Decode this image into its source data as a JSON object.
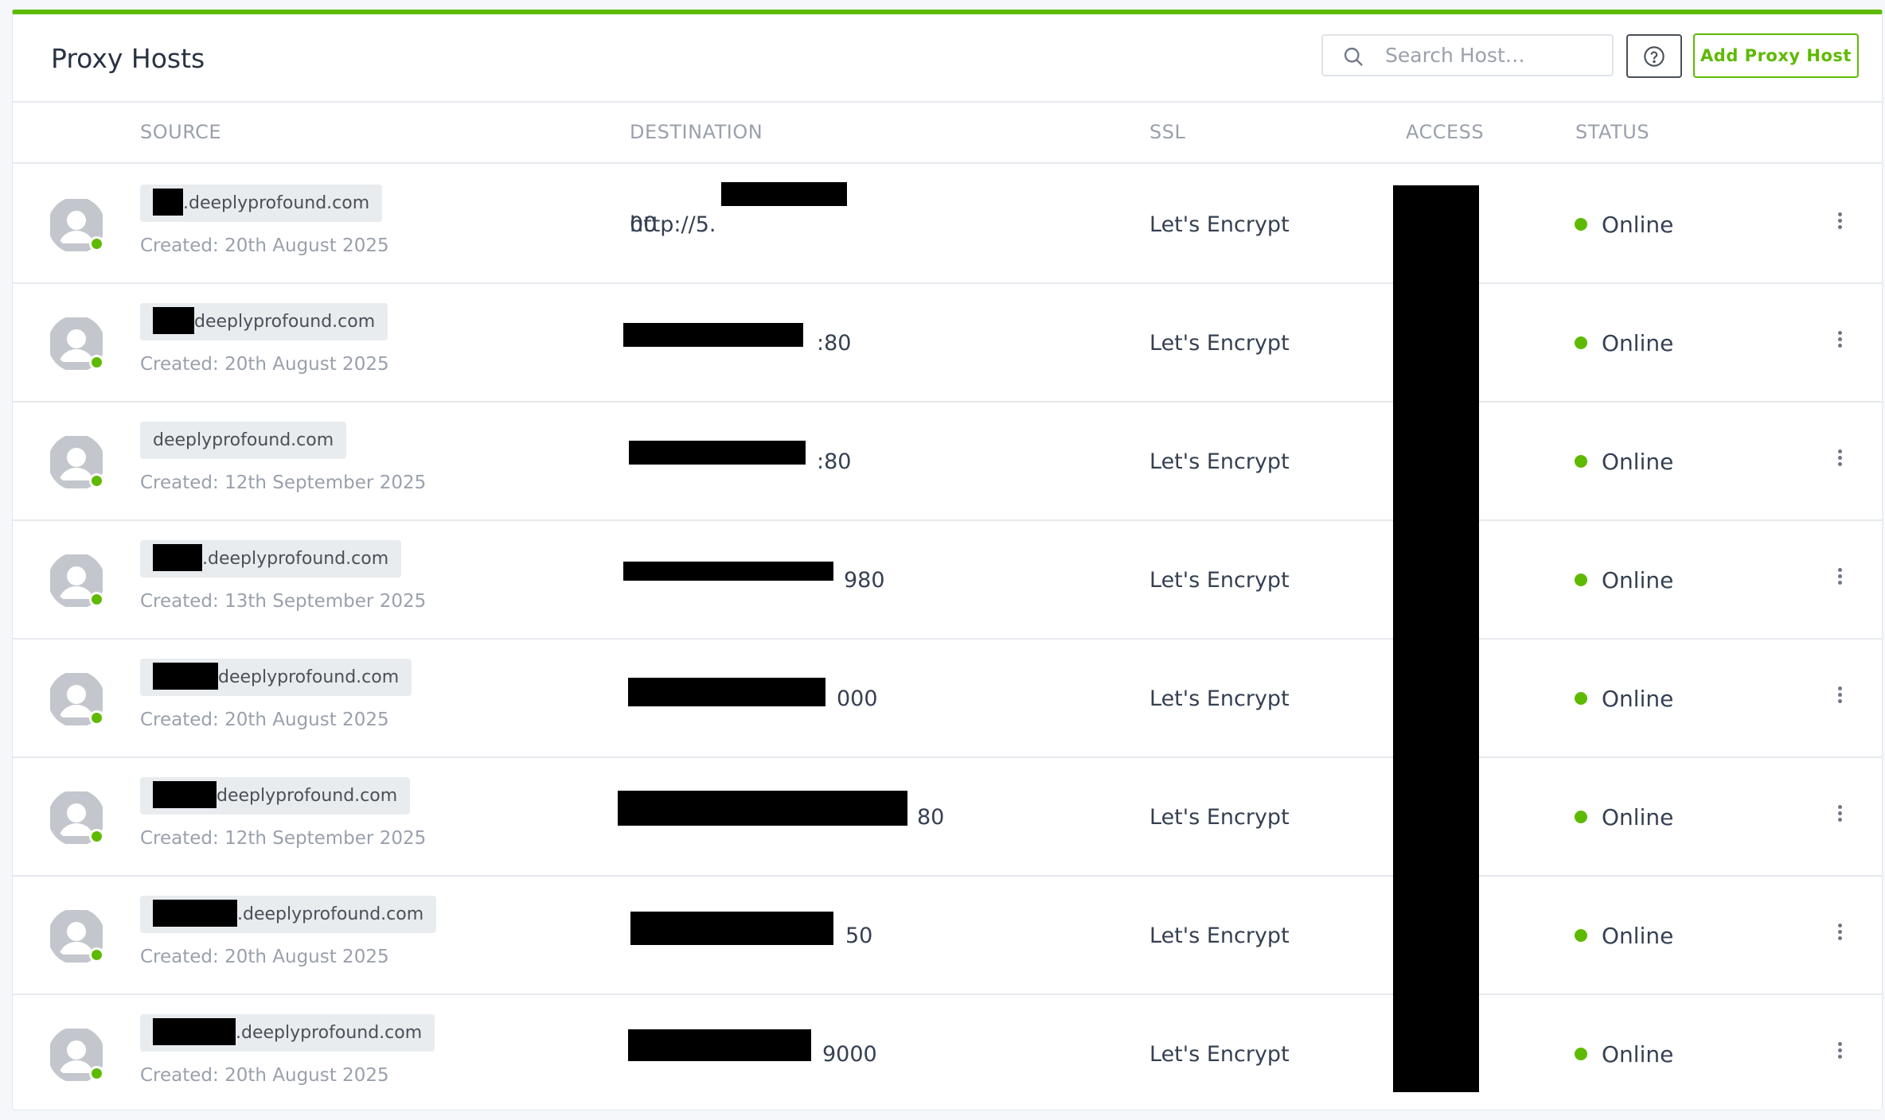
{
  "header": {
    "title": "Proxy Hosts",
    "search_placeholder": "Search Host…",
    "add_button_label": "Add Proxy Host"
  },
  "columns": {
    "source": "SOURCE",
    "destination": "DESTINATION",
    "ssl": "SSL",
    "access": "ACCESS",
    "status": "STATUS"
  },
  "rows": [
    {
      "domain": ".deeplyprofound.com",
      "created": "Created: 20th August 2025",
      "dest_prefix": "http://5.",
      "dest_suffix": "00",
      "ssl": "Let's Encrypt",
      "status": "Online"
    },
    {
      "domain": "deeplyprofound.com",
      "created": "Created: 20th August 2025",
      "dest_prefix": "",
      "dest_suffix": ":80",
      "ssl": "Let's Encrypt",
      "status": "Online"
    },
    {
      "domain": "deeplyprofound.com",
      "created": "Created: 12th September 2025",
      "dest_prefix": "",
      "dest_suffix": ":80",
      "ssl": "Let's Encrypt",
      "status": "Online"
    },
    {
      "domain": ".deeplyprofound.com",
      "created": "Created: 13th September 2025",
      "dest_prefix": "",
      "dest_suffix": "980",
      "ssl": "Let's Encrypt",
      "status": "Online"
    },
    {
      "domain": "deeplyprofound.com",
      "created": "Created: 20th August 2025",
      "dest_prefix": "",
      "dest_suffix": "000",
      "ssl": "Let's Encrypt",
      "status": "Online"
    },
    {
      "domain": "deeplyprofound.com",
      "created": "Created: 12th September 2025",
      "dest_prefix": "",
      "dest_suffix": "80",
      "ssl": "Let's Encrypt",
      "status": "Online"
    },
    {
      "domain": ".deeplyprofound.com",
      "created": "Created: 20th August 2025",
      "dest_prefix": "",
      "dest_suffix": "50",
      "ssl": "Let's Encrypt",
      "status": "Online"
    },
    {
      "domain": ".deeplyprofound.com",
      "created": "Created: 20th August 2025",
      "dest_prefix": "",
      "dest_suffix": "9000",
      "ssl": "Let's Encrypt",
      "status": "Online"
    }
  ],
  "colors": {
    "accent": "#5eba00",
    "muted": "#9aa0ac",
    "text": "#354052"
  },
  "icons": {
    "search": "search-icon",
    "help": "help-circle-icon",
    "avatar": "user-avatar-icon",
    "menu": "dots-vertical-icon"
  }
}
